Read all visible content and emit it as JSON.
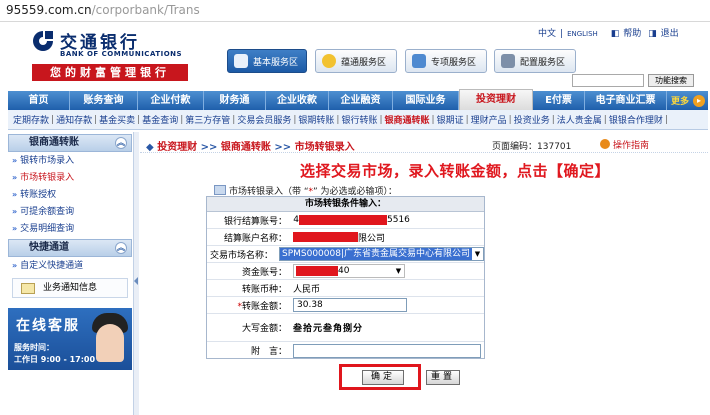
{
  "browser": {
    "url_host": "95559.com.cn",
    "url_path": "/corporbank/Trans"
  },
  "brand": {
    "name_cn": "交通银行",
    "name_en": "BANK OF COMMUNICATIONS",
    "slogan": "您的财富管理银行"
  },
  "top_links": {
    "lang_cn": "中文",
    "lang_en": "ENGLISH",
    "help": "帮助",
    "logout": "退出"
  },
  "service_buttons": [
    "基本服务区",
    "蕴通服务区",
    "专项服务区",
    "配置服务区"
  ],
  "func_search": {
    "button": "功能搜索",
    "value": ""
  },
  "nav": {
    "items": [
      "首页",
      "账务查询",
      "企业付款",
      "财务通",
      "企业收款",
      "企业融资",
      "国际业务",
      "投资理财",
      "E付票",
      "电子商业汇票"
    ],
    "active_index": 7,
    "more": "更多"
  },
  "subnav": {
    "items": [
      "定期存款",
      "通知存款",
      "基金买卖",
      "基金查询",
      "第三方存管",
      "交易会员服务",
      "银期转账",
      "银行转账",
      "银商通转账",
      "银期证",
      "理财产品",
      "投资业务",
      "法人贵金属",
      "银银合作理财"
    ],
    "active_index": 8
  },
  "sidebar": {
    "section1": "银商通转账",
    "items": [
      "银转市场录入",
      "市场转银录入",
      "转账授权",
      "可提余额查询",
      "交易明细查询"
    ],
    "active_index": 1,
    "section2": "快捷通道",
    "quick_items": [
      "自定义快捷通道"
    ],
    "notice": "业务通知信息",
    "kefu": {
      "title": "在线客服",
      "hours_label": "服务时间：",
      "hours": "工作日 9:00 - 17:00"
    }
  },
  "breadcrumb": {
    "parts": [
      "投资理财",
      "银商通转账",
      "市场转银录入"
    ],
    "sep": ">>"
  },
  "page_code": {
    "label": "页面编码：",
    "value": "137701"
  },
  "guide": "操作指南",
  "instruction": "选择交易市场，录入转账金额，点击【确定】",
  "form": {
    "hint_prefix": "市场转银录入（带 “",
    "hint_star": "*",
    "hint_suffix": "” 为必选或必输项）：",
    "title": "市场转银条件输入：",
    "rows": {
      "account_label": "银行结算账号：",
      "account_value": "5516",
      "account_name_label": "结算账户名称：",
      "account_name_value": "限公司",
      "market_label": "交易市场名称：",
      "market_value": "SPMS000008|广东省贵金属交易中心有限公司",
      "fund_label": "资金账号：",
      "fund_value": "40",
      "currency_label": "转账币种：",
      "currency_value": "人民币",
      "amount_label": "转账金额：",
      "amount_value": "30.38",
      "amount_cn_label": "大写金额：",
      "amount_cn_value": "叁拾元叁角捌分",
      "note_label": "附　言：",
      "note_value": ""
    },
    "confirm": "确定",
    "reset": "重置"
  },
  "colors": {
    "brand_red": "#c8161d",
    "nav_blue": "#1f5fab",
    "highlight_red": "#e0161d"
  }
}
